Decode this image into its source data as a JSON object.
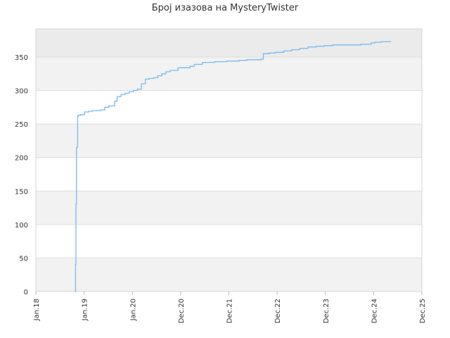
{
  "chart_data": {
    "type": "line",
    "title": "Број изазова на MysteryTwister",
    "xlabel": "",
    "ylabel": "",
    "x_ticks": [
      "Jan.18",
      "Jan.19",
      "Jan.20",
      "Dec.20",
      "Dec.21",
      "Dec.22",
      "Dec.23",
      "Dec.24",
      "Dec.25"
    ],
    "x_range": [
      "2018-01",
      "2025-12"
    ],
    "y_ticks": [
      0,
      50,
      100,
      150,
      200,
      250,
      300,
      350
    ],
    "ylim": [
      0,
      392
    ],
    "grid": true,
    "band_fill": "#f2f2f2",
    "band_top_fill": "#ebebeb",
    "line_color": "#7ab8f0",
    "series": [
      {
        "x": [
          "2018-10-20",
          "2018-10-25",
          "2018-10-28",
          "2018-11-01",
          "2018-11-10",
          "2018-11-15",
          "2018-12-01",
          "2019-01-01",
          "2019-02-01",
          "2019-03-01",
          "2019-05-01",
          "2019-06-01",
          "2019-07-01",
          "2019-08-15",
          "2019-09-01",
          "2019-10-01",
          "2019-11-01",
          "2019-12-01",
          "2020-01-01",
          "2020-02-01",
          "2020-03-01",
          "2020-04-01",
          "2020-05-01",
          "2020-06-01",
          "2020-07-01",
          "2020-08-01",
          "2020-09-01",
          "2020-10-01",
          "2020-12-01",
          "2021-03-01",
          "2021-04-01",
          "2021-06-01",
          "2021-09-01",
          "2021-12-01",
          "2022-01-15",
          "2022-03-01",
          "2022-05-01",
          "2022-07-01",
          "2022-08-15",
          "2022-09-01",
          "2022-10-15",
          "2022-12-01",
          "2023-02-01",
          "2023-04-01",
          "2023-06-01",
          "2023-08-01",
          "2023-10-01",
          "2023-12-01",
          "2024-02-01",
          "2024-04-01",
          "2024-06-01",
          "2024-09-01",
          "2024-11-15",
          "2024-12-15",
          "2025-02-01",
          "2025-04-15"
        ],
        "y": [
          0,
          40,
          130,
          215,
          262,
          263,
          264,
          268,
          269,
          270,
          271,
          275,
          277,
          284,
          291,
          294,
          296,
          298,
          300,
          302,
          310,
          317,
          318,
          319,
          322,
          325,
          328,
          330,
          334,
          336,
          339,
          342,
          343,
          344,
          344,
          345,
          346,
          346,
          347,
          355,
          356,
          357,
          359,
          361,
          363,
          365,
          366,
          367,
          368,
          368,
          368,
          369,
          371,
          372,
          373,
          373
        ]
      }
    ]
  }
}
